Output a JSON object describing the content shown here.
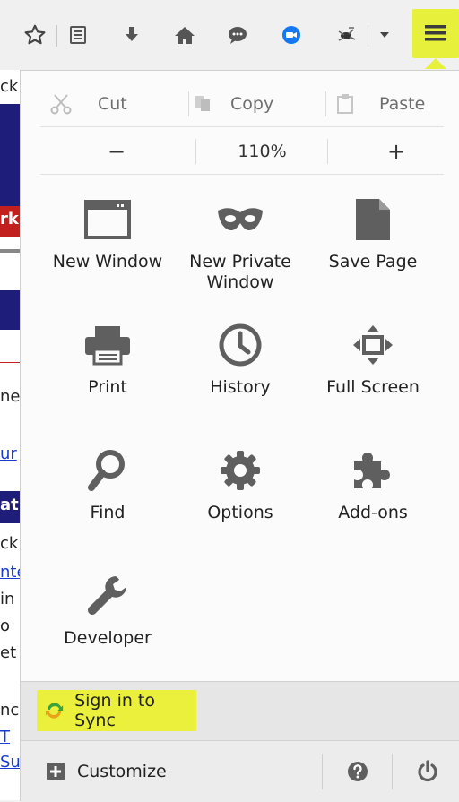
{
  "edit": {
    "cut": "Cut",
    "copy": "Copy",
    "paste": "Paste"
  },
  "zoom": {
    "minus": "−",
    "level": "110%",
    "plus": "+"
  },
  "grid": [
    {
      "label": "New Window",
      "icon": "window-icon"
    },
    {
      "label": "New Private Window",
      "icon": "private-mask-icon"
    },
    {
      "label": "Save Page",
      "icon": "page-icon"
    },
    {
      "label": "Print",
      "icon": "printer-icon"
    },
    {
      "label": "History",
      "icon": "clock-icon"
    },
    {
      "label": "Full Screen",
      "icon": "fullscreen-icon"
    },
    {
      "label": "Find",
      "icon": "magnifier-icon"
    },
    {
      "label": "Options",
      "icon": "gear-icon"
    },
    {
      "label": "Add-ons",
      "icon": "puzzle-icon"
    },
    {
      "label": "Developer",
      "icon": "wrench-icon"
    }
  ],
  "sync": {
    "label": "Sign in to Sync"
  },
  "footer": {
    "customize": "Customize"
  },
  "background": {
    "fragments": [
      "ck",
      "rk",
      "ne",
      "ur",
      "at",
      "ck",
      "nte",
      "in",
      "o",
      "et",
      "nc",
      "T",
      "Su"
    ]
  },
  "colors": {
    "highlight": "#e7f03a",
    "icon": "#6d6d6d",
    "sync_icon": "#3aa33a",
    "toolbar_blue": "#1577f2"
  }
}
